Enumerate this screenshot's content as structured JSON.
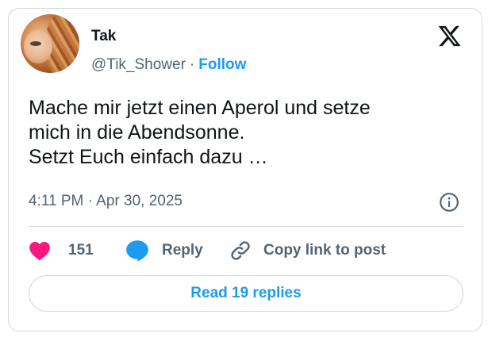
{
  "author": {
    "name": "Tak",
    "handle": "@Tik_Shower",
    "separator": "·",
    "follow_label": "Follow"
  },
  "tweet": {
    "lines": [
      "Mache mir jetzt einen Aperol und setze",
      "mich in die Abendsonne.",
      "Setzt Euch einfach dazu …"
    ],
    "timestamp": "4:11 PM · Apr 30, 2025"
  },
  "actions": {
    "like_count": "151",
    "reply_label": "Reply",
    "copy_label": "Copy link to post"
  },
  "read_replies_label": "Read 19 replies",
  "colors": {
    "accent": "#1d9bf0",
    "like": "#f91880",
    "text": "#0f1419",
    "secondary": "#536471",
    "border": "#cfd9de"
  },
  "icons": {
    "brand": "x-logo-icon",
    "info": "info-icon",
    "like": "heart-icon",
    "reply": "speech-bubble-icon",
    "copy": "link-icon"
  }
}
